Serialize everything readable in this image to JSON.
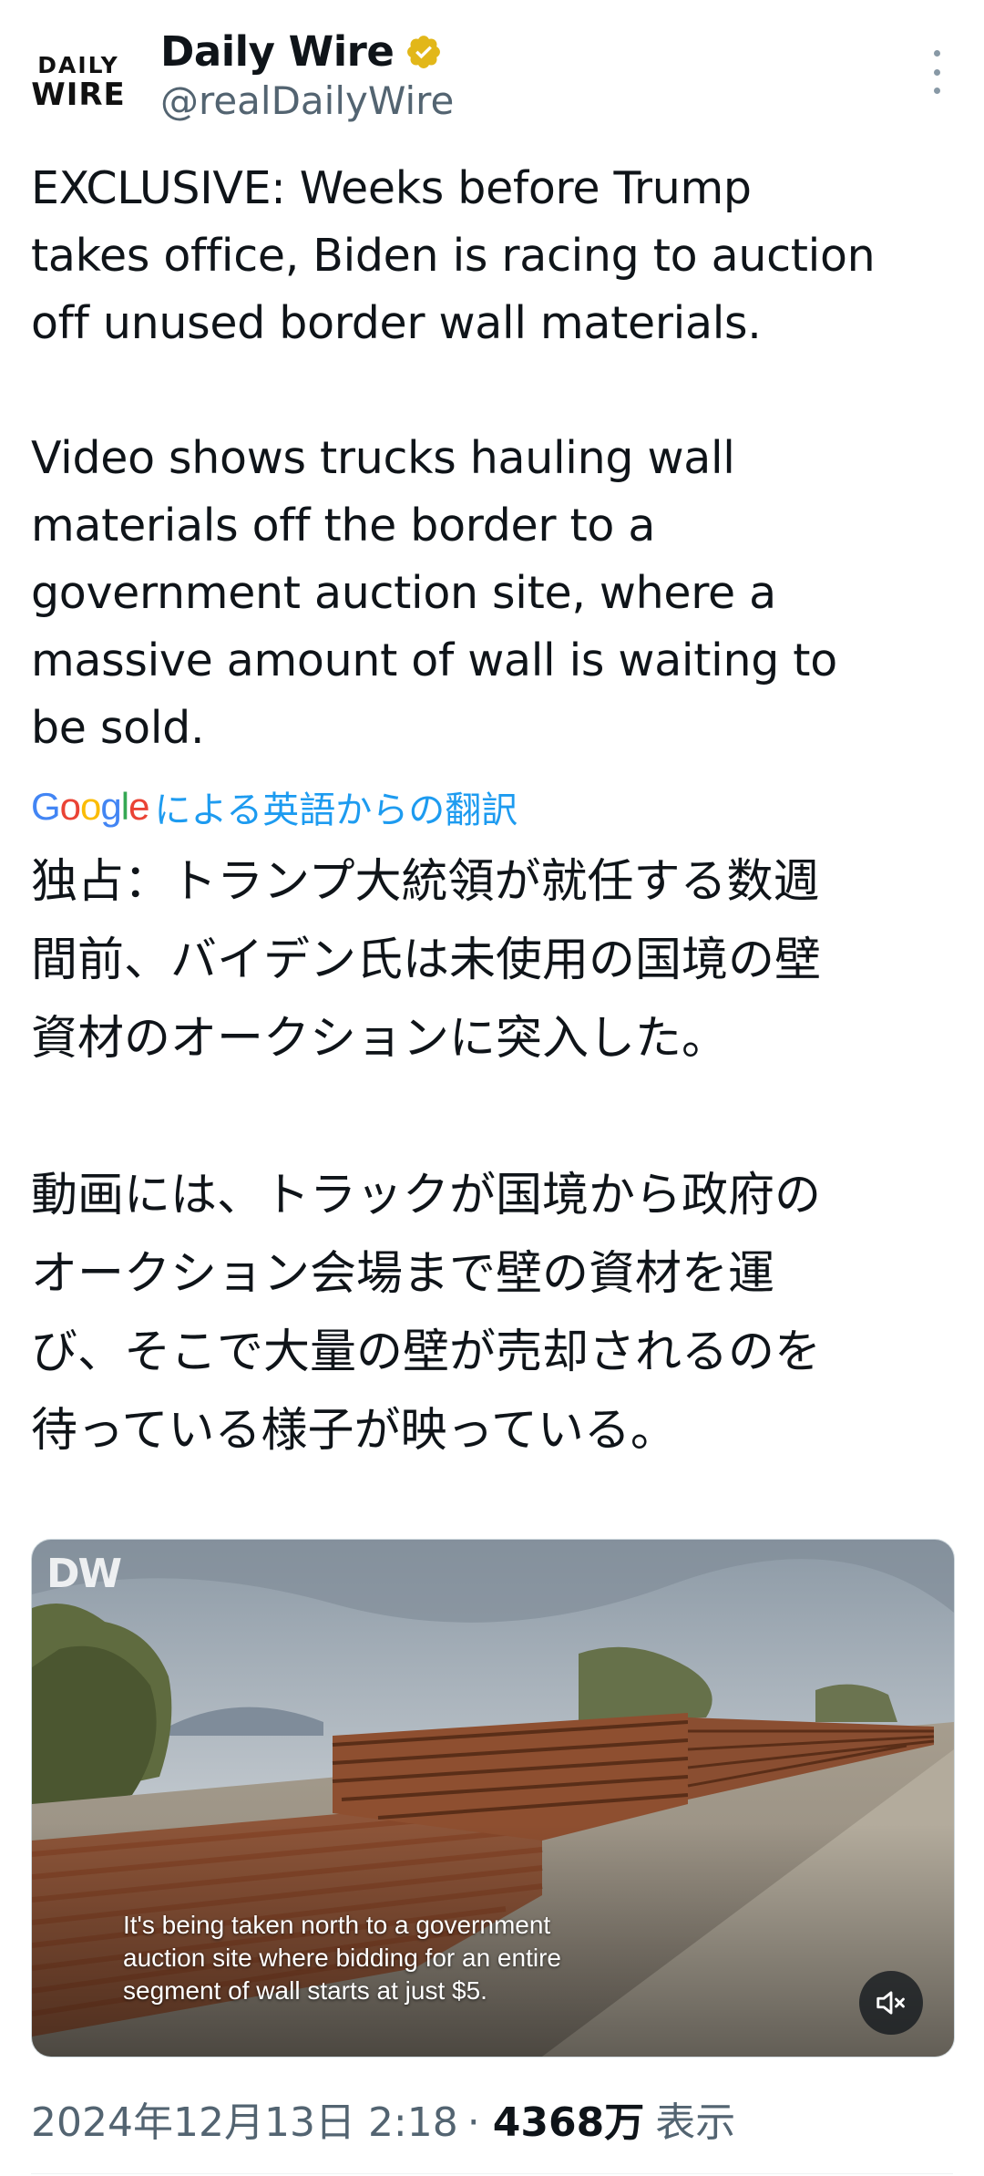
{
  "header": {
    "avatar_line1": "DAILY",
    "avatar_line2": "WIRE",
    "display_name": "Daily Wire",
    "handle": "@realDailyWire"
  },
  "tweet": {
    "text": "EXCLUSIVE: Weeks before Trump\ntakes office, Biden is racing to auction\noff unused border wall materials.\n\nVideo shows trucks hauling wall\nmaterials off the border to a\ngovernment auction site, where a\nmassive amount of wall is waiting to\nbe sold.",
    "translate_label": "による英語からの翻訳",
    "translated_text": "独占：トランプ大統領が就任する数週\n間前、バイデン氏は未使用の国境の壁\n資材のオークションに突入した。\n\n動画には、トラックが国境から政府の\nオークション会場まで壁の資材を運\nび、そこで大量の壁が売却されるのを\n待っている様子が映っている。"
  },
  "media": {
    "watermark": "DW",
    "caption": "It's being taken north to a government\nauction site where bidding for an entire\nsegment of wall starts at just $5."
  },
  "meta": {
    "timestamp": "2024年12月13日 2:18",
    "separator": "·",
    "view_count": "4368万",
    "views_label": "表示"
  },
  "icons": {
    "verified": "verified-badge-icon",
    "more": "more-options-icon",
    "mute": "muted-speaker-icon"
  },
  "colors": {
    "verified_gold": "#e2b719",
    "link_blue": "#1d9bf0",
    "secondary_text": "#536471"
  }
}
